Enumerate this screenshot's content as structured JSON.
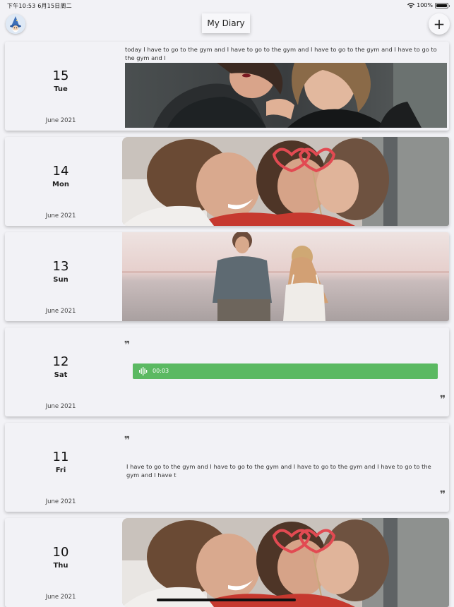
{
  "status_bar": {
    "time_date": "下午10:53   6月15日周二",
    "battery_percent": "100%",
    "battery_level": 1.0
  },
  "header": {
    "title": "My Diary",
    "add_label": "+",
    "avatar_icon": "wizard-avatar-icon"
  },
  "entries": [
    {
      "day": "15",
      "weekday": "Tue",
      "month": "June 2021",
      "type": "text-photo",
      "text": "today I have to go to the gym and I have to go to the gym and I have to go to the gym and I have to go to the gym and I"
    },
    {
      "day": "14",
      "weekday": "Mon",
      "month": "June 2021",
      "type": "photo"
    },
    {
      "day": "13",
      "weekday": "Sun",
      "month": "June 2021",
      "type": "photo"
    },
    {
      "day": "12",
      "weekday": "Sat",
      "month": "June 2021",
      "type": "audio",
      "duration": "00:03",
      "quote_open": "❞",
      "quote_close": "❞"
    },
    {
      "day": "11",
      "weekday": "Fri",
      "month": "June 2021",
      "type": "text",
      "text": "I have to go to the gym and I have to go to the gym and I have to go to the gym and I have to go to the gym and I have t",
      "quote_open": "❞",
      "quote_close": "❞"
    },
    {
      "day": "10",
      "weekday": "Thu",
      "month": "June 2021",
      "type": "photo"
    }
  ],
  "colors": {
    "background": "#f2f2f6",
    "audio_bar": "#5bb962"
  }
}
